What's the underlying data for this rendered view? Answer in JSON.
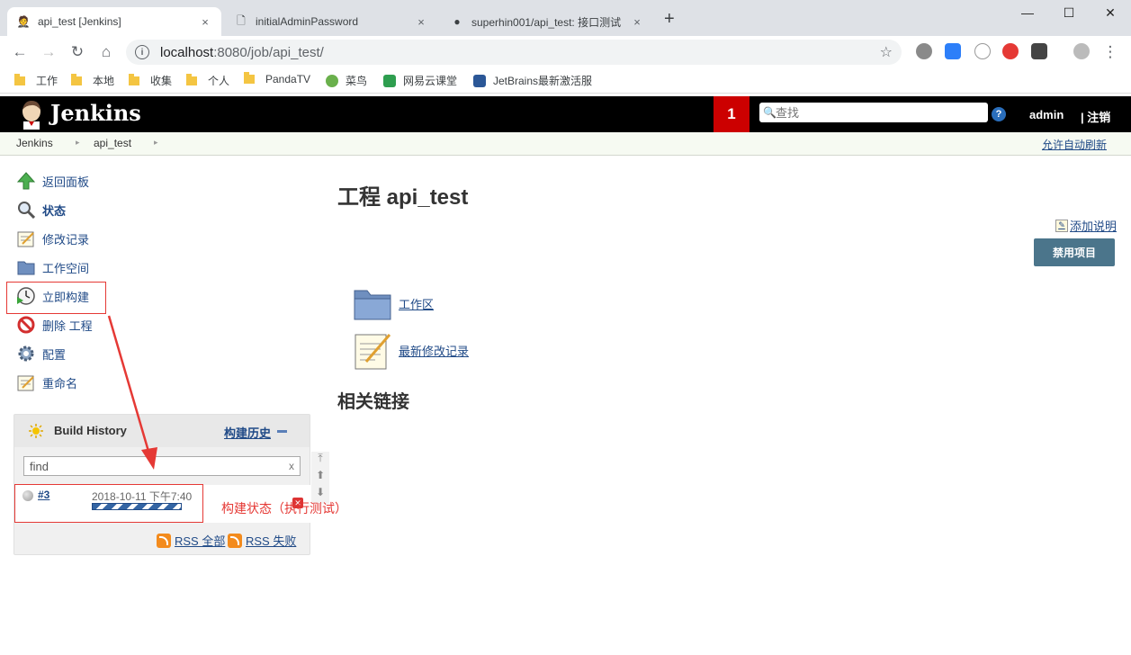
{
  "browser": {
    "tabs": [
      {
        "title": "api_test [Jenkins]",
        "close": "×"
      },
      {
        "title": "initialAdminPassword",
        "close": "×"
      },
      {
        "title": "superhin001/api_test: 接口测试",
        "close": "×"
      }
    ],
    "new_tab": "+",
    "window_controls": {
      "minimize": "—",
      "maximize": "☐",
      "close": "✕"
    },
    "address": {
      "host": "localhost",
      "rest": ":8080/job/api_test/"
    },
    "bookmarks": [
      "工作",
      "本地",
      "收集",
      "个人",
      "PandaTV",
      "菜鸟",
      "网易云课堂",
      "JetBrains最新激活服"
    ]
  },
  "header": {
    "brand": "Jenkins",
    "notification_count": "1",
    "search_placeholder": "查找",
    "help": "?",
    "user": "admin",
    "logout": "| 注销"
  },
  "breadcrumb": {
    "items": [
      "Jenkins",
      "api_test"
    ],
    "auto_refresh": "允许自动刷新"
  },
  "sidebar": {
    "tasks": [
      {
        "label": "返回面板",
        "icon": "up-arrow-icon"
      },
      {
        "label": "状态",
        "icon": "magnifier-icon"
      },
      {
        "label": "修改记录",
        "icon": "notepad-icon"
      },
      {
        "label": "工作空间",
        "icon": "folder-icon"
      },
      {
        "label": "立即构建",
        "icon": "clock-icon"
      },
      {
        "label": "删除 工程",
        "icon": "no-entry-icon"
      },
      {
        "label": "配置",
        "icon": "gear-icon"
      },
      {
        "label": "重命名",
        "icon": "notepad-icon"
      }
    ]
  },
  "build_history": {
    "title": "Build History",
    "trend_link": "构建历史",
    "find_placeholder": "find",
    "find_clear": "x",
    "builds": [
      {
        "number": "#3",
        "date": "2018-10-11 下午7:40",
        "progress": 1.0,
        "status_color": "#9a9a9a"
      }
    ],
    "rss_all": "RSS 全部",
    "rss_failed": "RSS 失败"
  },
  "main": {
    "title": "工程 api_test",
    "add_description": "添加说明",
    "disable_button": "禁用项目",
    "links": [
      {
        "label": "工作区",
        "icon": "folder-icon"
      },
      {
        "label": "最新修改记录",
        "icon": "notepad-icon"
      }
    ],
    "related_heading": "相关链接"
  },
  "annotation": {
    "text": "构建状态（执行测试）",
    "color": "#e53935"
  },
  "colors": {
    "header_bg": "#000000",
    "notification_bg": "#cc0000",
    "link": "#204a87",
    "button": "#4b758b"
  }
}
